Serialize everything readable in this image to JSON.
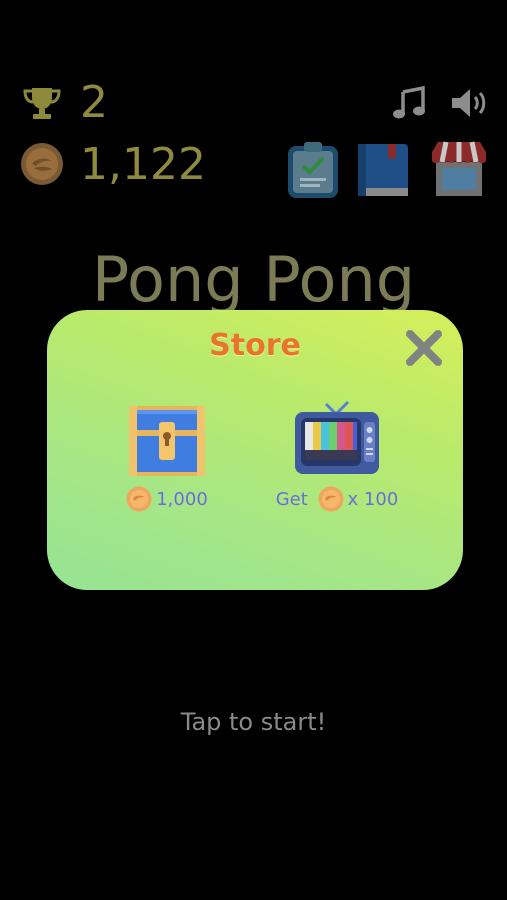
{
  "hud": {
    "best_score": "2",
    "coins": "1,122"
  },
  "title": "Pong Pong",
  "store": {
    "title": "Store",
    "items": [
      {
        "icon": "treasure-chest-icon",
        "price_label": "1,000"
      },
      {
        "icon": "tv-icon",
        "prefix": "Get",
        "suffix": "x 100"
      }
    ]
  },
  "prompt": "Tap to start!",
  "colors": {
    "score_text": "#8f8a3d",
    "title_text": "#7b7b55",
    "store_title": "#e8752b",
    "price_text": "#6a6fd8"
  }
}
